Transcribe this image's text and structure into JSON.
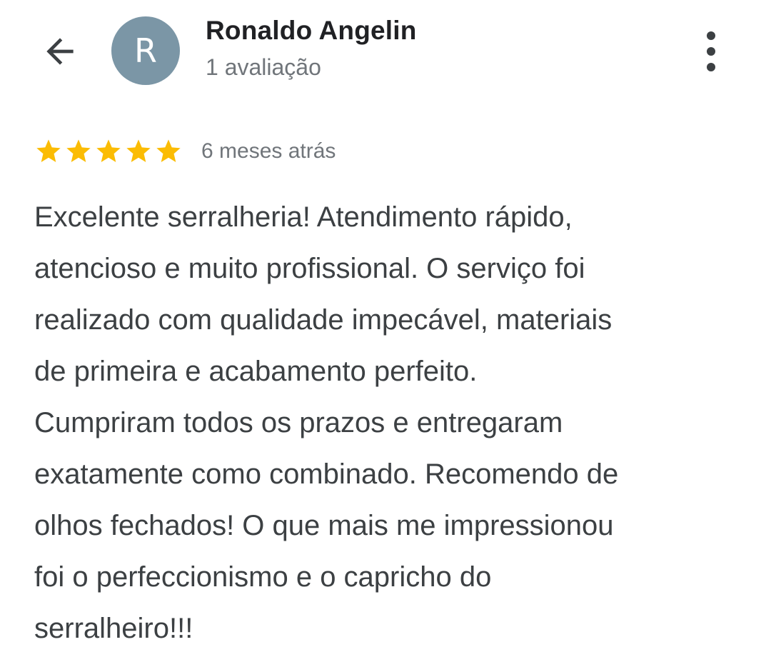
{
  "header": {
    "back_icon": "arrow-back-icon",
    "avatar_letter": "R",
    "avatar_color": "#7b96a6",
    "reviewer_name": "Ronaldo Angelin",
    "review_count": "1 avaliação",
    "more_icon": "more-vertical-icon"
  },
  "review": {
    "rating": 5,
    "rating_max": 5,
    "star_color": "#fbbc04",
    "star_icon": "star-icon",
    "time": "6 meses atrás",
    "lines": [
      "Excelente serralheria! Atendimento rápido,",
      "atencioso e muito profissional. O serviço foi",
      "realizado com qualidade impecável, materiais",
      "de primeira e acabamento perfeito.",
      "Cumpriram todos os prazos e entregaram",
      "exatamente como combinado. Recomendo de",
      "olhos fechados! O que mais me impressionou",
      "foi o perfeccionismo e o capricho do",
      "serralheiro!!!"
    ]
  }
}
